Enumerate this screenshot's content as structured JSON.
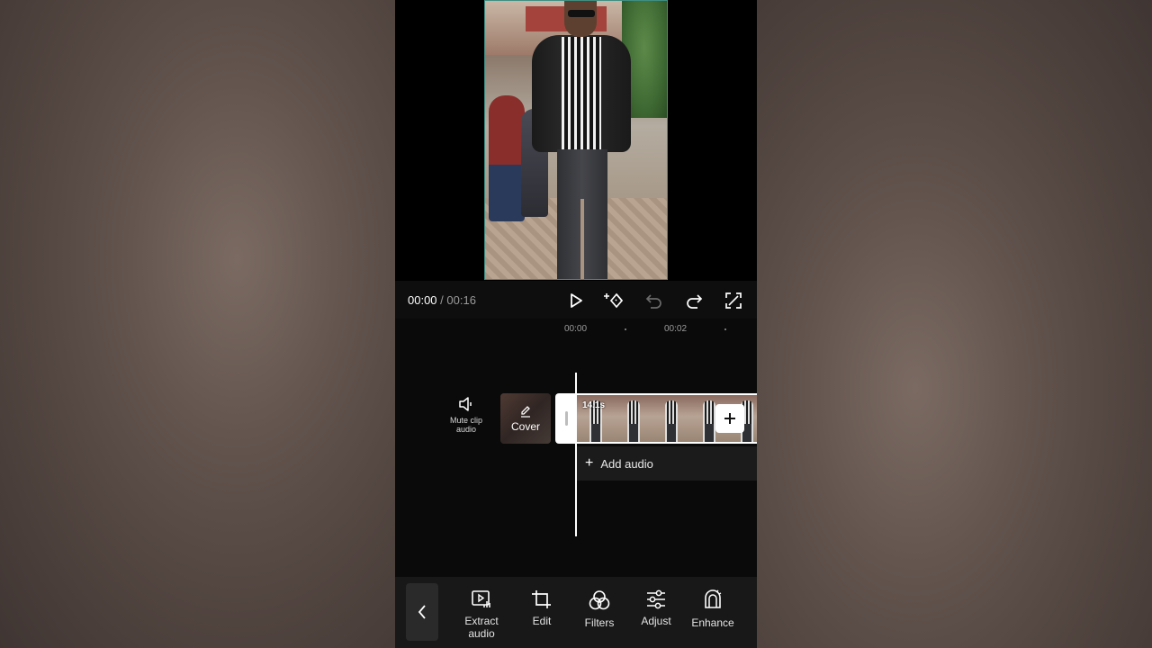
{
  "player": {
    "current_time": "00:00",
    "separator": "/",
    "total_time": "00:16"
  },
  "ruler": {
    "ticks": [
      "00:00",
      "00:02"
    ]
  },
  "track": {
    "mute_label": "Mute clip audio",
    "cover_label": "Cover",
    "clip_duration": "14.1s",
    "add_audio_label": "Add audio"
  },
  "toolbar": {
    "items": [
      {
        "label": "Extract audio",
        "icon": "extract-audio-icon"
      },
      {
        "label": "Edit",
        "icon": "crop-icon"
      },
      {
        "label": "Filters",
        "icon": "filters-icon"
      },
      {
        "label": "Adjust",
        "icon": "adjust-icon"
      },
      {
        "label": "Enhance",
        "icon": "enhance-icon"
      }
    ]
  },
  "colors": {
    "accent_frame": "#3f8f82",
    "background": "#000000",
    "toolbar_bg": "#181818"
  }
}
